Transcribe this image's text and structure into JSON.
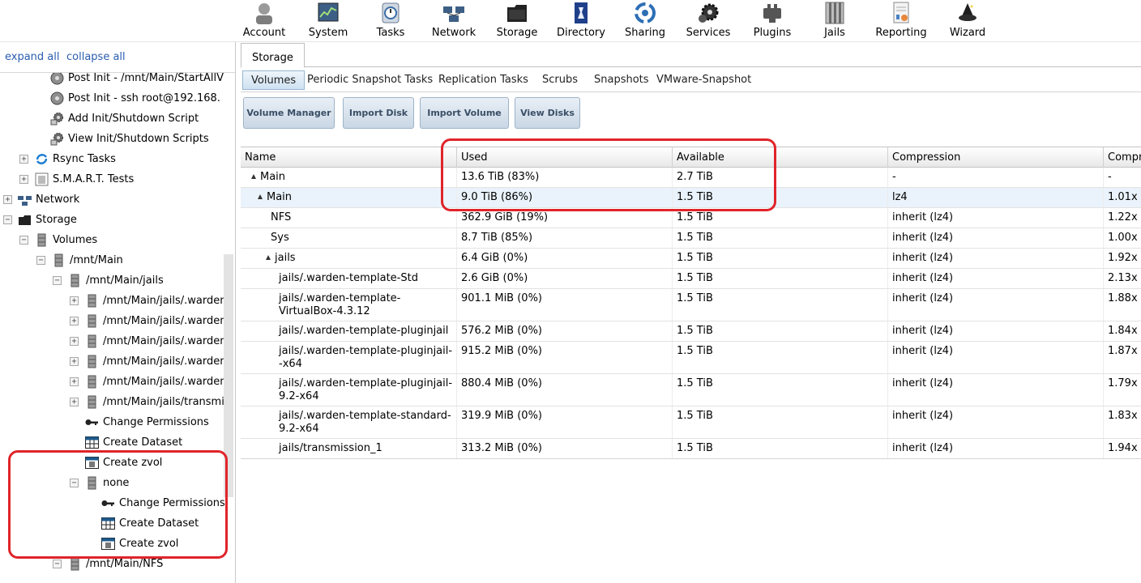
{
  "toolbar": {
    "items": [
      {
        "label": "Account",
        "icon": "account-icon"
      },
      {
        "label": "System",
        "icon": "system-icon"
      },
      {
        "label": "Tasks",
        "icon": "tasks-icon"
      },
      {
        "label": "Network",
        "icon": "network-icon"
      },
      {
        "label": "Storage",
        "icon": "storage-icon"
      },
      {
        "label": "Directory",
        "icon": "directory-icon"
      },
      {
        "label": "Sharing",
        "icon": "sharing-icon"
      },
      {
        "label": "Services",
        "icon": "services-icon"
      },
      {
        "label": "Plugins",
        "icon": "plugins-icon"
      },
      {
        "label": "Jails",
        "icon": "jails-icon"
      },
      {
        "label": "Reporting",
        "icon": "reporting-icon"
      },
      {
        "label": "Wizard",
        "icon": "wizard-icon"
      }
    ]
  },
  "tree": {
    "expand_all": "expand all",
    "collapse_all": "collapse all",
    "items": [
      {
        "label": "Post Init - /mnt/Main/StartAllV",
        "icon": "disk-icon"
      },
      {
        "label": "Post Init - ssh root@192.168.",
        "icon": "disk-icon"
      },
      {
        "label": "Add Init/Shutdown Script",
        "icon": "gear-add-icon"
      },
      {
        "label": "View Init/Shutdown Scripts",
        "icon": "gear-view-icon"
      },
      {
        "label": "Rsync Tasks",
        "icon": "rsync-icon",
        "toggle": "+"
      },
      {
        "label": "S.M.A.R.T. Tests",
        "icon": "smart-icon",
        "toggle": "+"
      },
      {
        "label": "Network",
        "icon": "network-icon",
        "toggle": "+"
      },
      {
        "label": "Storage",
        "icon": "storage-icon",
        "toggle": "−"
      },
      {
        "label": "Volumes",
        "icon": "volume-icon",
        "toggle": "−"
      },
      {
        "label": "/mnt/Main",
        "icon": "volume-icon",
        "toggle": "−"
      },
      {
        "label": "/mnt/Main/jails",
        "icon": "volume-icon",
        "toggle": "−"
      },
      {
        "label": "/mnt/Main/jails/.warden",
        "icon": "volume-icon",
        "toggle": "+"
      },
      {
        "label": "/mnt/Main/jails/.warden",
        "icon": "volume-icon",
        "toggle": "+"
      },
      {
        "label": "/mnt/Main/jails/.warden",
        "icon": "volume-icon",
        "toggle": "+"
      },
      {
        "label": "/mnt/Main/jails/.warden",
        "icon": "volume-icon",
        "toggle": "+"
      },
      {
        "label": "/mnt/Main/jails/.warden",
        "icon": "volume-icon",
        "toggle": "+"
      },
      {
        "label": "/mnt/Main/jails/transmi",
        "icon": "volume-icon",
        "toggle": "+"
      },
      {
        "label": "Change Permissions",
        "icon": "key-icon"
      },
      {
        "label": "Create Dataset",
        "icon": "dataset-icon"
      },
      {
        "label": "Create zvol",
        "icon": "zvol-icon"
      },
      {
        "label": "none",
        "icon": "volume-icon",
        "toggle": "−"
      },
      {
        "label": "Change Permissions",
        "icon": "key-icon"
      },
      {
        "label": "Create Dataset",
        "icon": "dataset-icon"
      },
      {
        "label": "Create zvol",
        "icon": "zvol-icon"
      },
      {
        "label": "/mnt/Main/NFS",
        "icon": "volume-icon",
        "toggle": "−"
      }
    ]
  },
  "main": {
    "tab": "Storage",
    "subtabs": [
      "Volumes",
      "Periodic Snapshot Tasks",
      "Replication Tasks",
      "Scrubs",
      "Snapshots",
      "VMware-Snapshot"
    ],
    "buttons": [
      "Volume Manager",
      "Import Disk",
      "Import Volume",
      "View Disks"
    ],
    "columns": [
      "Name",
      "Used",
      "Available",
      "Compression",
      "Compr"
    ],
    "rows": [
      {
        "name": "Main",
        "used": "13.6 TiB (83%)",
        "available": "2.7 TiB",
        "compression": "-",
        "ratio": "-"
      },
      {
        "name": "Main",
        "used": "9.0 TiB (86%)",
        "available": "1.5 TiB",
        "compression": "lz4",
        "ratio": "1.01x"
      },
      {
        "name": "NFS",
        "used": "362.9 GiB (19%)",
        "available": "1.5 TiB",
        "compression": "inherit (lz4)",
        "ratio": "1.22x"
      },
      {
        "name": "Sys",
        "used": "8.7 TiB (85%)",
        "available": "1.5 TiB",
        "compression": "inherit (lz4)",
        "ratio": "1.00x"
      },
      {
        "name": "jails",
        "used": "6.4 GiB (0%)",
        "available": "1.5 TiB",
        "compression": "inherit (lz4)",
        "ratio": "1.92x"
      },
      {
        "name": "jails/.warden-template-Std",
        "used": "2.6 GiB (0%)",
        "available": "1.5 TiB",
        "compression": "inherit (lz4)",
        "ratio": "2.13x"
      },
      {
        "name": "jails/.warden-template-VirtualBox-4.3.12",
        "used": "901.1 MiB (0%)",
        "available": "1.5 TiB",
        "compression": "inherit (lz4)",
        "ratio": "1.88x"
      },
      {
        "name": "jails/.warden-template-pluginjail",
        "used": "576.2 MiB (0%)",
        "available": "1.5 TiB",
        "compression": "inherit (lz4)",
        "ratio": "1.84x"
      },
      {
        "name": "jails/.warden-template-pluginjail--x64",
        "used": "915.2 MiB (0%)",
        "available": "1.5 TiB",
        "compression": "inherit (lz4)",
        "ratio": "1.87x"
      },
      {
        "name": "jails/.warden-template-pluginjail-9.2-x64",
        "used": "880.4 MiB (0%)",
        "available": "1.5 TiB",
        "compression": "inherit (lz4)",
        "ratio": "1.79x"
      },
      {
        "name": "jails/.warden-template-standard-9.2-x64",
        "used": "319.9 MiB (0%)",
        "available": "1.5 TiB",
        "compression": "inherit (lz4)",
        "ratio": "1.83x"
      },
      {
        "name": "jails/transmission_1",
        "used": "313.2 MiB (0%)",
        "available": "1.5 TiB",
        "compression": "inherit (lz4)",
        "ratio": "1.94x"
      }
    ]
  },
  "colors": {
    "annotation": "#e0242a",
    "link": "#2a5db0",
    "selected_row": "#eaf3fb"
  }
}
